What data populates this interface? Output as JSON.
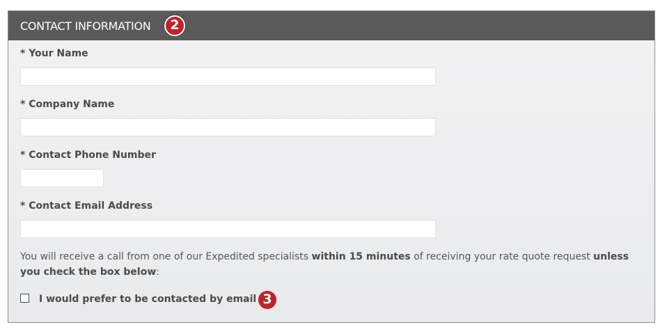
{
  "section": {
    "title": "CONTACT INFORMATION",
    "step_badge": "2"
  },
  "fields": {
    "name": {
      "label": "* Your Name",
      "value": "",
      "placeholder": ""
    },
    "company": {
      "label": "* Company Name",
      "value": "",
      "placeholder": ""
    },
    "phone": {
      "label": "* Contact Phone Number",
      "value": "",
      "placeholder": ""
    },
    "email": {
      "label": "* Contact Email Address",
      "value": "",
      "placeholder": ""
    }
  },
  "notice": {
    "part1": "You will receive a call from one of our Expedited specialists ",
    "bold1": "within 15 minutes",
    "part2": " of receiving your rate quote request ",
    "bold2": "unless you check the box below",
    "part3": ":"
  },
  "email_preference": {
    "label": "I would prefer to be contacted by email",
    "checked": false,
    "step_badge": "3"
  },
  "colors": {
    "header_bg": "#5a5a5a",
    "badge": "#c0222b",
    "panel_bg": "#eeeff0"
  }
}
